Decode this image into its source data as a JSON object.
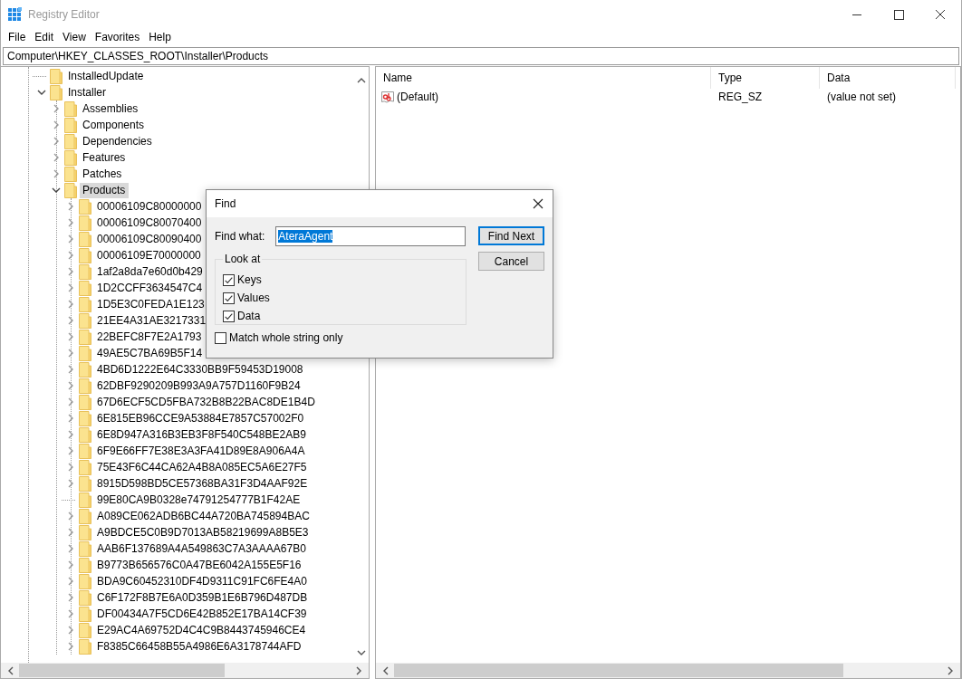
{
  "window": {
    "title": "Registry Editor"
  },
  "menu": [
    "File",
    "Edit",
    "View",
    "Favorites",
    "Help"
  ],
  "address": "Computer\\HKEY_CLASSES_ROOT\\Installer\\Products",
  "tree": [
    {
      "label": "InstalledUpdate",
      "expandable": false,
      "selected": false
    },
    {
      "label": "Installer",
      "expandable": true,
      "expanded": true,
      "selected": false,
      "children": [
        {
          "label": "Assemblies",
          "expandable": true,
          "expanded": false,
          "selected": false
        },
        {
          "label": "Components",
          "expandable": true,
          "expanded": false,
          "selected": false
        },
        {
          "label": "Dependencies",
          "expandable": true,
          "expanded": false,
          "selected": false
        },
        {
          "label": "Features",
          "expandable": true,
          "expanded": false,
          "selected": false
        },
        {
          "label": "Patches",
          "expandable": true,
          "expanded": false,
          "selected": false
        },
        {
          "label": "Products",
          "expandable": true,
          "expanded": true,
          "selected": true,
          "children": [
            {
              "label": "00006109C80000000",
              "expandable": true,
              "expanded": false,
              "selected": false
            },
            {
              "label": "00006109C80070400",
              "expandable": true,
              "expanded": false,
              "selected": false
            },
            {
              "label": "00006109C80090400",
              "expandable": true,
              "expanded": false,
              "selected": false
            },
            {
              "label": "00006109E70000000",
              "expandable": true,
              "expanded": false,
              "selected": false
            },
            {
              "label": "1af2a8da7e60d0b429",
              "expandable": true,
              "expanded": false,
              "selected": false
            },
            {
              "label": "1D2CCFF3634547C4",
              "expandable": true,
              "expanded": false,
              "selected": false
            },
            {
              "label": "1D5E3C0FEDA1E123",
              "expandable": true,
              "expanded": false,
              "selected": false
            },
            {
              "label": "21EE4A31AE3217331",
              "expandable": true,
              "expanded": false,
              "selected": false
            },
            {
              "label": "22BEFC8F7E2A1793",
              "expandable": true,
              "expanded": false,
              "selected": false
            },
            {
              "label": "49AE5C7BA69B5F14",
              "expandable": true,
              "expanded": false,
              "selected": false
            },
            {
              "label": "4BD6D1222E64C3330BB9F59453D19008",
              "expandable": true,
              "expanded": false,
              "selected": false
            },
            {
              "label": "62DBF9290209B993A9A757D1160F9B24",
              "expandable": true,
              "expanded": false,
              "selected": false
            },
            {
              "label": "67D6ECF5CD5FBA732B8B22BAC8DE1B4D",
              "expandable": true,
              "expanded": false,
              "selected": false
            },
            {
              "label": "6E815EB96CCE9A53884E7857C57002F0",
              "expandable": true,
              "expanded": false,
              "selected": false
            },
            {
              "label": "6E8D947A316B3EB3F8F540C548BE2AB9",
              "expandable": true,
              "expanded": false,
              "selected": false
            },
            {
              "label": "6F9E66FF7E38E3A3FA41D89E8A906A4A",
              "expandable": true,
              "expanded": false,
              "selected": false
            },
            {
              "label": "75E43F6C44CA62A4B8A085EC5A6E27F5",
              "expandable": true,
              "expanded": false,
              "selected": false
            },
            {
              "label": "8915D598BD5CE57368BA31F3D4AAF92E",
              "expandable": true,
              "expanded": false,
              "selected": false
            },
            {
              "label": "99E80CA9B0328e74791254777B1F42AE",
              "expandable": false,
              "selected": false
            },
            {
              "label": "A089CE062ADB6BC44A720BA745894BAC",
              "expandable": true,
              "expanded": false,
              "selected": false
            },
            {
              "label": "A9BDCE5C0B9D7013AB58219699A8B5E3",
              "expandable": true,
              "expanded": false,
              "selected": false
            },
            {
              "label": "AAB6F137689A4A549863C7A3AAAA67B0",
              "expandable": true,
              "expanded": false,
              "selected": false
            },
            {
              "label": "B9773B656576C0A47BE6042A155E5F16",
              "expandable": true,
              "expanded": false,
              "selected": false
            },
            {
              "label": "BDA9C60452310DF4D9311C91FC6FE4A0",
              "expandable": true,
              "expanded": false,
              "selected": false
            },
            {
              "label": "C6F172F8B7E6A0D359B1E6B796D487DB",
              "expandable": true,
              "expanded": false,
              "selected": false
            },
            {
              "label": "DF00434A7F5CD6E42B852E17BA14CF39",
              "expandable": true,
              "expanded": false,
              "selected": false
            },
            {
              "label": "E29AC4A69752D4C4C9B8443745946CE4",
              "expandable": true,
              "expanded": false,
              "selected": false
            },
            {
              "label": "F8385C66458B55A4986E6A3178744AFD",
              "expandable": true,
              "expanded": false,
              "selected": false
            }
          ]
        }
      ]
    }
  ],
  "values": {
    "columns": [
      "Name",
      "Type",
      "Data"
    ],
    "rows": [
      {
        "name": "(Default)",
        "type": "REG_SZ",
        "data": "(value not set)"
      }
    ]
  },
  "find_dialog": {
    "title": "Find",
    "find_what_label": "Find what:",
    "find_what": "AteraAgent",
    "find_next": "Find Next",
    "cancel": "Cancel",
    "look_at": {
      "label": "Look at",
      "options": [
        {
          "label": "Keys",
          "checked": true
        },
        {
          "label": "Values",
          "checked": true
        },
        {
          "label": "Data",
          "checked": true
        }
      ]
    },
    "match_whole": {
      "label": "Match whole string only",
      "checked": false
    }
  }
}
